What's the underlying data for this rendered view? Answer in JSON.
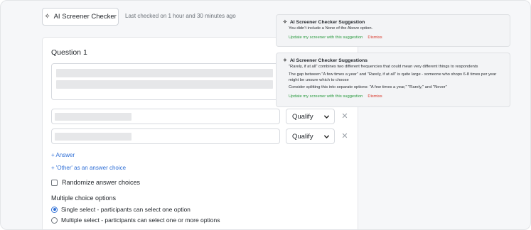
{
  "topbar": {
    "checker_button_label": "AI Screener Checker",
    "last_checked": "Last checked on 1 hour and 30 minutes ago"
  },
  "question": {
    "title": "Question 1",
    "answers": [
      {
        "qualify": "Qualify"
      },
      {
        "qualify": "Qualify"
      }
    ],
    "add_answer": "+ Answer",
    "add_other": "+ 'Other' as an answer choice",
    "randomize_label": "Randomize answer choices",
    "randomize_checked": false,
    "mc_options_title": "Multiple choice options",
    "single_select_label": "Single select - participants can select one option",
    "multi_select_label": "Multiple select - participants can select one or more options",
    "selected_mode": "single"
  },
  "suggestions": [
    {
      "title": "AI Screener Checker Suggestion",
      "lines": [
        "You didn't include a None of the Above option."
      ],
      "update_label": "Update my screener with this suggestion",
      "dismiss_label": "Dismiss"
    },
    {
      "title": "AI Screener Checker Suggestions",
      "lines": [
        "\"Rarely, if at all\" combines two different frequencies that could mean very different things to respondents",
        "The gap between \"A few times a year\" and \"Rarely, if at all\" is quite large - someone who shops 6-8 times per year might be unsure which to choose",
        "Consider splitting this into separate options: \"A few times a year,\" \"Rarely,\" and \"Never\""
      ],
      "update_label": "Update my screener with this suggestion",
      "dismiss_label": "Dismiss"
    }
  ],
  "colors": {
    "link_blue": "#2f6fd6",
    "update_green": "#2a9a3f",
    "dismiss_red": "#d9392b"
  },
  "icons": {
    "sparkle": "sparkle-icon",
    "chevron": "chevron-down-icon",
    "remove": "close-icon"
  }
}
